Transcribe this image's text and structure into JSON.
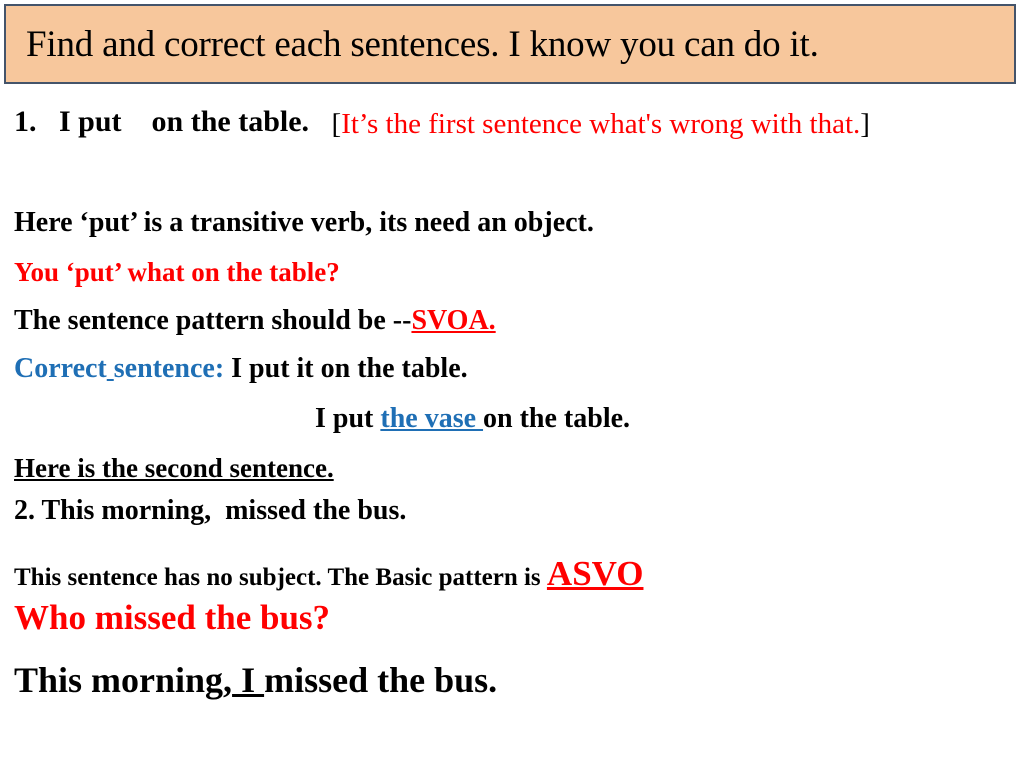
{
  "slide": {
    "title": "Find and correct each sentences. I know you can do it.",
    "title_bg_color": "#F7C79C",
    "title_border_color": "#44546A",
    "background_color": "#FFFFFF"
  },
  "colors": {
    "red": "#FF0000",
    "blue": "#1F6FB5",
    "black": "#000000"
  },
  "item1": {
    "sentence": "1.   I put    on the table.   ",
    "note_open_bracket": "[",
    "note_text": "It’s the first sentence what's wrong with that.",
    "note_close_bracket": "]"
  },
  "explanation1": {
    "line_transitive": "Here ‘put’ is a transitive verb, its need an object.",
    "line_question": "You ‘put’ what on the table?",
    "line_pattern_prefix": "The sentence pattern should be --",
    "line_pattern_code": "SVOA.",
    "line_correct_label_a": "Correct",
    "line_correct_label_space": " ",
    "line_correct_label_b": "sentence:",
    "line_correct_rest": " I put it on the table.",
    "line_vase_prefix": "I put ",
    "line_vase_highlight": "the vase ",
    "line_vase_suffix": "on the table."
  },
  "item2": {
    "heading": "Here is the second sentence.",
    "sentence": "2. This morning,  missed the bus.",
    "explain_prefix": "This sentence has no subject. The Basic pattern is ",
    "explain_code": "ASVO",
    "question": "Who missed the bus?",
    "answer_prefix": "This morning,",
    "answer_subject": " I ",
    "answer_suffix": "missed the bus."
  }
}
